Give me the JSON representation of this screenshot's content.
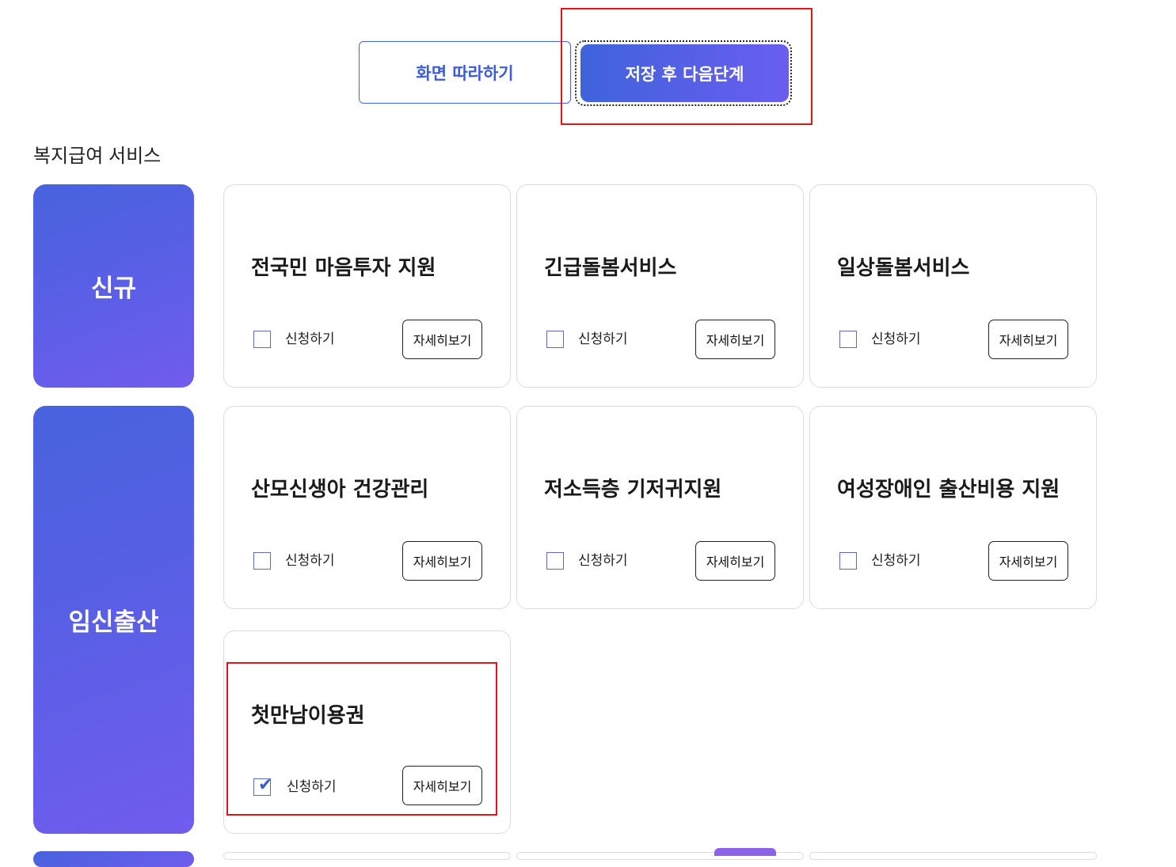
{
  "top": {
    "follow_label": "화면 따라하기",
    "save_label": "저장 후 다음단계"
  },
  "section_title": "복지급여 서비스",
  "categories": [
    {
      "label": "신규"
    },
    {
      "label": "임신출산"
    }
  ],
  "cards": [
    {
      "title": "전국민 마음투자 지원",
      "apply_label": "신청하기",
      "detail_label": "자세히보기",
      "checked": false
    },
    {
      "title": "긴급돌봄서비스",
      "apply_label": "신청하기",
      "detail_label": "자세히보기",
      "checked": false
    },
    {
      "title": "일상돌봄서비스",
      "apply_label": "신청하기",
      "detail_label": "자세히보기",
      "checked": false
    },
    {
      "title": "산모신생아 건강관리",
      "apply_label": "신청하기",
      "detail_label": "자세히보기",
      "checked": false
    },
    {
      "title": "저소득층 기저귀지원",
      "apply_label": "신청하기",
      "detail_label": "자세히보기",
      "checked": false
    },
    {
      "title": "여성장애인 출산비용 지원",
      "apply_label": "신청하기",
      "detail_label": "자세히보기",
      "checked": false
    },
    {
      "title": "첫만남이용권",
      "apply_label": "신청하기",
      "detail_label": "자세히보기",
      "checked": true
    }
  ],
  "colors": {
    "accent": "#3f63dc",
    "accent_end": "#715cee",
    "highlight": "#e0151c"
  }
}
